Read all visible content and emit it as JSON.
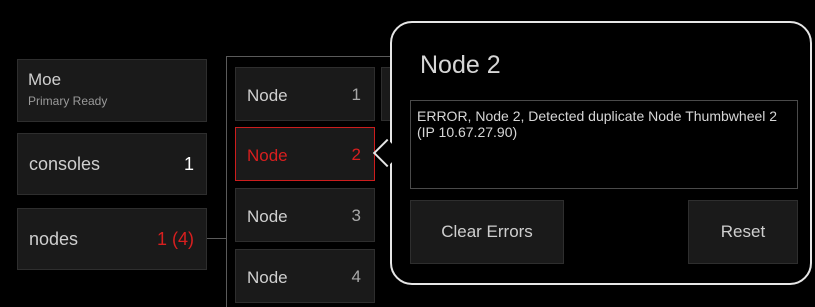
{
  "system": {
    "name": "Moe",
    "status": "Primary Ready"
  },
  "rows": {
    "consoles": {
      "label": "consoles",
      "count": "1"
    },
    "nodes": {
      "label": "nodes",
      "count": "1 (4)"
    }
  },
  "node_list": [
    {
      "label": "Node",
      "number": "1",
      "state": "normal"
    },
    {
      "label": "Node",
      "number": "2",
      "state": "error"
    },
    {
      "label": "Node",
      "number": "3",
      "state": "normal"
    },
    {
      "label": "Node",
      "number": "4",
      "state": "normal"
    }
  ],
  "popup": {
    "title": "Node 2",
    "message": "ERROR, Node 2, Detected duplicate Node Thumbwheel 2 (IP 10.67.27.90)",
    "clear_label": "Clear Errors",
    "reset_label": "Reset"
  },
  "colors": {
    "background": "#000000",
    "tile": "#1a1a1a",
    "error": "#d81f1f",
    "popup_border": "#e6e6e6"
  }
}
